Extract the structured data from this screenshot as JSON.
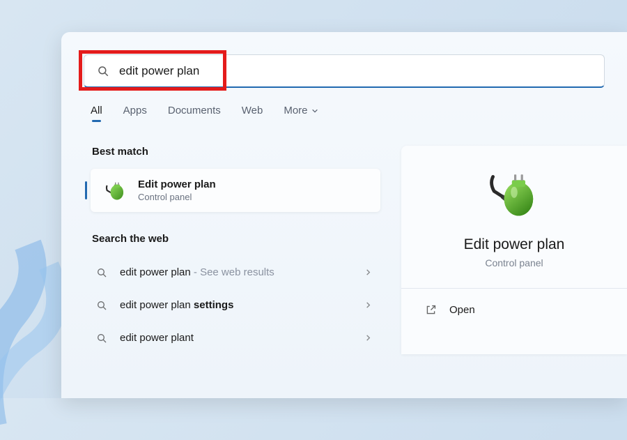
{
  "search": {
    "query": "edit power plan"
  },
  "tabs": {
    "all": "All",
    "apps": "Apps",
    "documents": "Documents",
    "web": "Web",
    "more": "More"
  },
  "sections": {
    "best_match": "Best match",
    "search_web": "Search the web"
  },
  "best_match": {
    "title": "Edit power plan",
    "subtitle": "Control panel"
  },
  "web_results": [
    {
      "text": "edit power plan",
      "hint": " - See web results",
      "bold": ""
    },
    {
      "text": "edit power plan ",
      "hint": "",
      "bold": "settings"
    },
    {
      "text": "edit power plant",
      "hint": "",
      "bold": ""
    }
  ],
  "preview": {
    "title": "Edit power plan",
    "subtitle": "Control panel",
    "open": "Open"
  }
}
